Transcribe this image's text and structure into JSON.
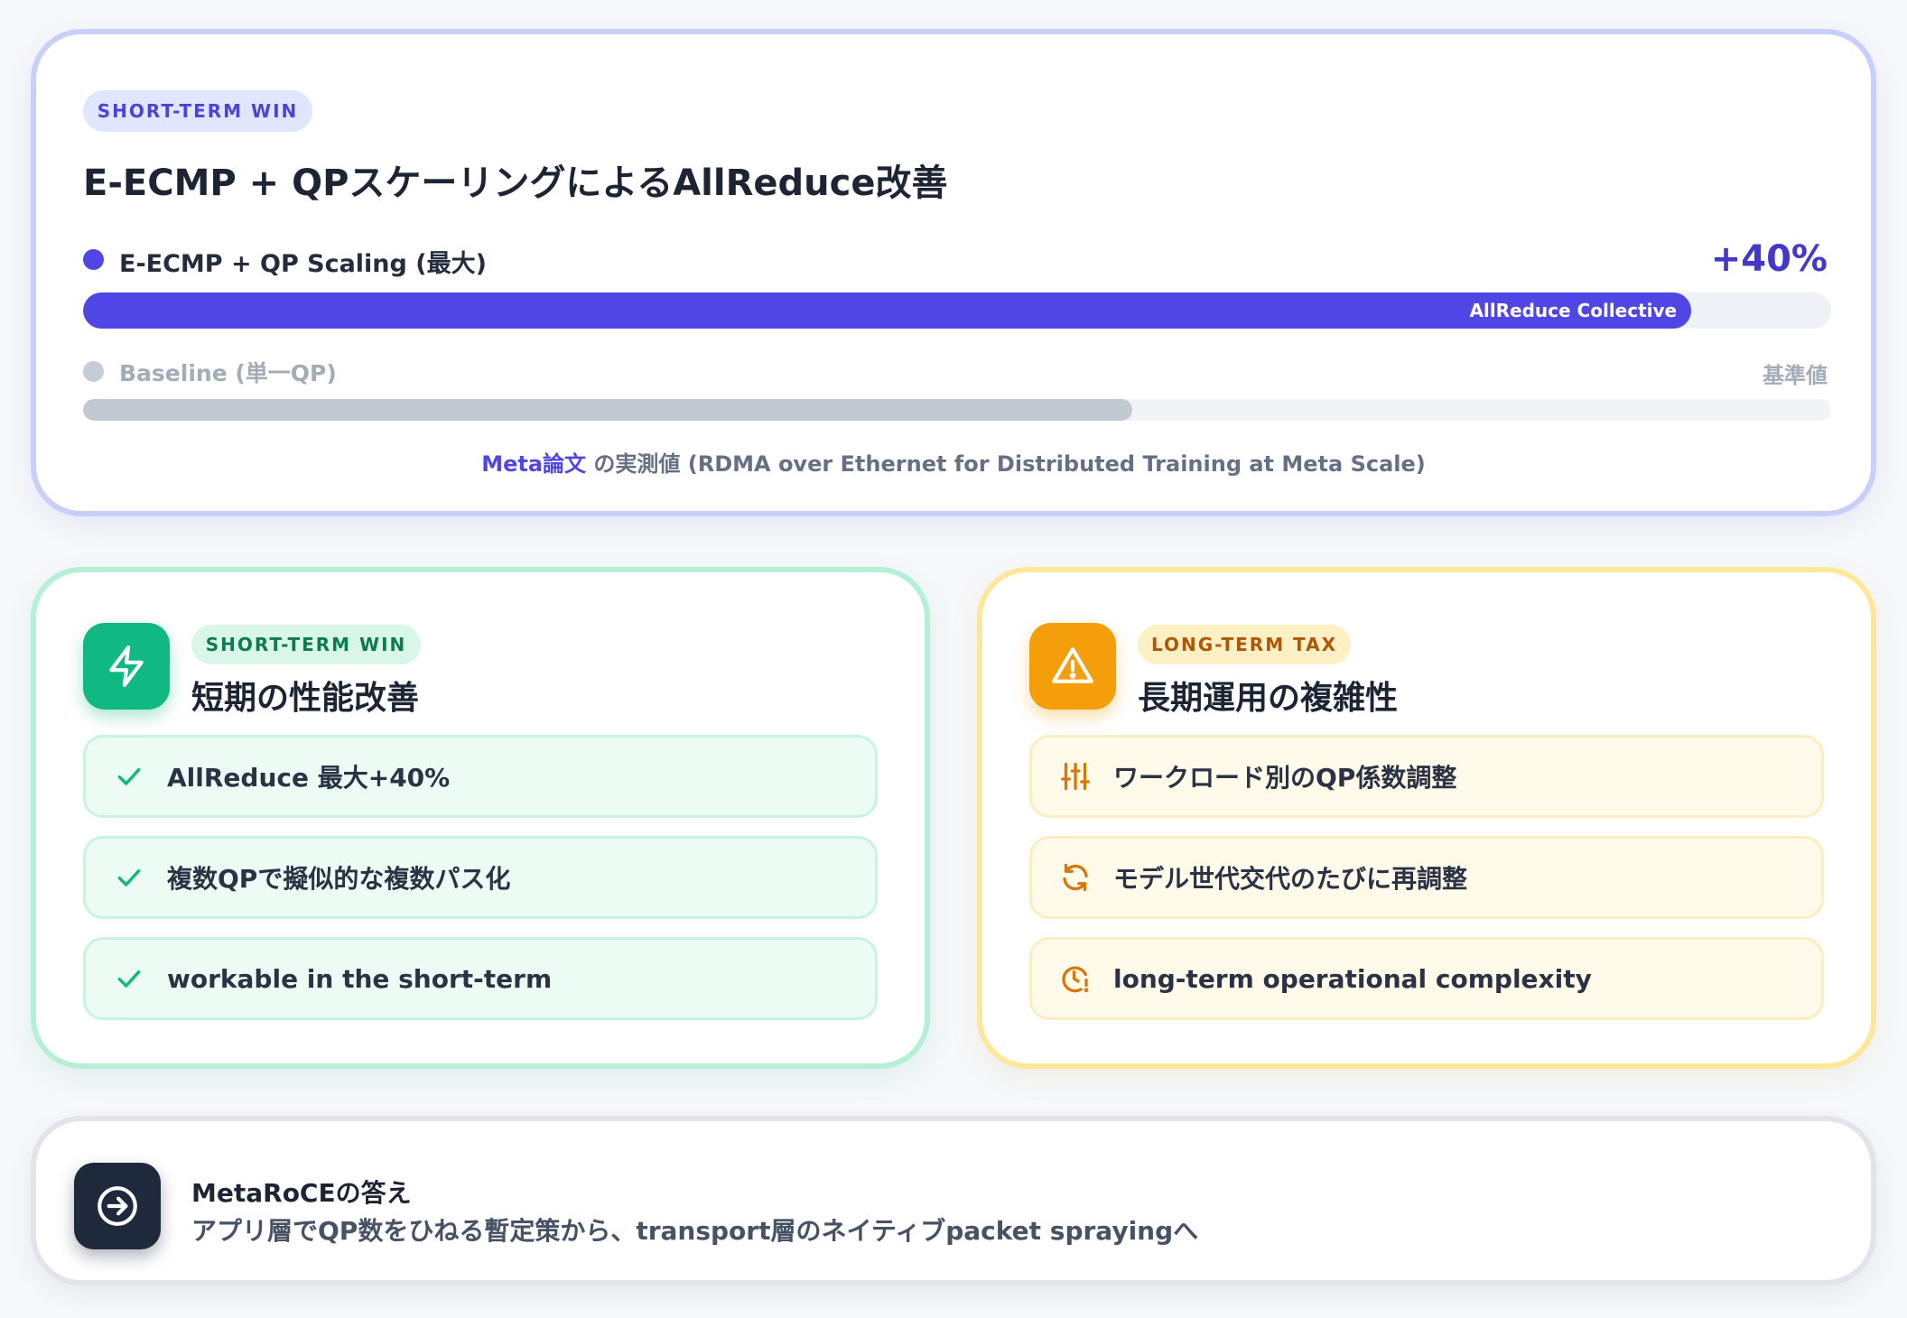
{
  "top": {
    "badge": "SHORT-TERM WIN",
    "title": "E-ECMP + QPスケーリングによるAllReduce改善",
    "eecmp": {
      "label": "E-ECMP + QP Scaling (最大)",
      "value": "+40%",
      "bar_label": "AllReduce Collective",
      "fill_fraction": 0.92,
      "color": "#4f46e5"
    },
    "baseline": {
      "label": "Baseline (単一QP)",
      "right_label": "基準値",
      "fill_fraction": 0.6,
      "color": "#c3c9d2"
    },
    "source": {
      "accent": "Meta論文",
      "text": " の実測値 (RDMA over Ethernet for Distributed Training at Meta Scale)"
    }
  },
  "win": {
    "icon": "lightning-icon",
    "badge": "SHORT-TERM WIN",
    "title": "短期の性能改善",
    "items": [
      {
        "icon": "check-icon",
        "text": "AllReduce 最大+40%"
      },
      {
        "icon": "check-icon",
        "text": "複数QPで擬似的な複数パス化"
      },
      {
        "icon": "check-icon",
        "text": "workable in the short-term"
      }
    ],
    "accent": "#10b981"
  },
  "tax": {
    "icon": "warning-icon",
    "badge": "LONG-TERM TAX",
    "title": "長期運用の複雑性",
    "items": [
      {
        "icon": "sliders-icon",
        "text": "ワークロード別のQP係数調整"
      },
      {
        "icon": "refresh-icon",
        "text": "モデル世代交代のたびに再調整"
      },
      {
        "icon": "clock-alert-icon",
        "text": "long-term operational complexity"
      }
    ],
    "accent": "#f59e0b"
  },
  "bottom": {
    "icon": "arrow-right-circle-icon",
    "title": "MetaRoCEの答え",
    "text": "アプリ層でQP数をひねる暫定策から、transport層のネイティブpacket sprayingへ"
  }
}
